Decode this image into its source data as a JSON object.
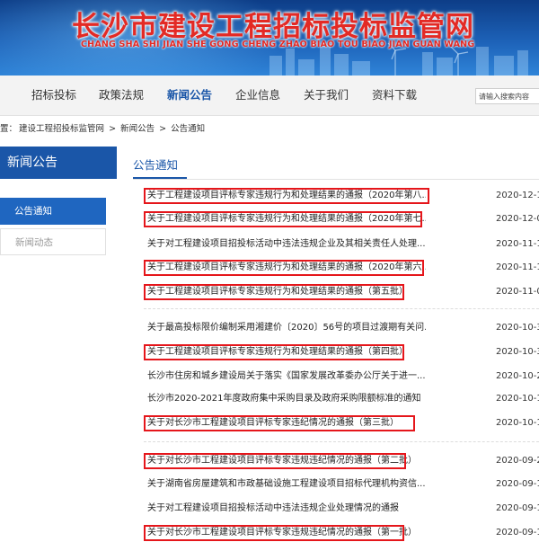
{
  "banner": {
    "title": "长沙市建设工程招标投标监管网",
    "pinyin": "CHANG SHA SHI JIAN SHE GONG CHENG ZHAO BIAO TOU BIAO JIAN GUAN WANG"
  },
  "nav": {
    "items": [
      "招标投标",
      "政策法规",
      "新闻公告",
      "企业信息",
      "关于我们",
      "资料下载"
    ],
    "active": "新闻公告",
    "search_placeholder": "请输入搜索内容"
  },
  "breadcrumb": {
    "prefix": "置：",
    "items": [
      "建设工程招投标监管网",
      ">",
      "新闻公告",
      ">",
      "公告通知"
    ]
  },
  "sidebar": {
    "heading": "新闻公告",
    "items": [
      {
        "label": "公告通知",
        "active": true
      },
      {
        "label": "新闻动态",
        "active": false
      }
    ]
  },
  "main": {
    "heading": "公告通知",
    "rows": [
      {
        "title": "关于工程建设项目评标专家违规行为和处理结果的通报（2020年第八...",
        "date": "2020-12-1",
        "highlighted": true
      },
      {
        "title": "关于工程建设项目评标专家违规行为和处理结果的通报（2020年第七...",
        "date": "2020-12-0",
        "highlighted": true
      },
      {
        "title": "关于对工程建设项目招投标活动中违法违规企业及其相关责任人处理...",
        "date": "2020-11-1",
        "highlighted": false
      },
      {
        "title": "关于工程建设项目评标专家违规行为和处理结果的通报（2020年第六...",
        "date": "2020-11-1",
        "highlighted": true
      },
      {
        "title": "关于工程建设项目评标专家违规行为和处理结果的通报（第五批）",
        "date": "2020-11-0",
        "highlighted": true
      },
      {
        "title": "关于最高投标限价编制采用湘建价〔2020〕56号的项目过渡期有关问...",
        "date": "2020-10-3",
        "highlighted": false
      },
      {
        "title": "关于工程建设项目评标专家违规行为和处理结果的通报（第四批）",
        "date": "2020-10-3",
        "highlighted": true
      },
      {
        "title": "长沙市住房和城乡建设局关于落实《国家发展改革委办公厅关于进一...",
        "date": "2020-10-2",
        "highlighted": false
      },
      {
        "title": "长沙市2020-2021年度政府集中采购目录及政府采购限额标准的通知",
        "date": "2020-10-1",
        "highlighted": false
      },
      {
        "title": "关于对长沙市工程建设项目评标专家违纪情况的通报（第三批）",
        "date": "2020-10-1",
        "highlighted": true
      },
      {
        "title": "关于对长沙市工程建设项目评标专家违规违纪情况的通报（第二批）",
        "date": "2020-09-2",
        "highlighted": true
      },
      {
        "title": "关于湖南省房屋建筑和市政基础设施工程建设项目招标代理机构资信...",
        "date": "2020-09-1",
        "highlighted": false
      },
      {
        "title": "关于对工程建设项目招投标活动中违法违规企业处理情况的通报",
        "date": "2020-09-1",
        "highlighted": false
      },
      {
        "title": "关于对长沙市工程建设项目评标专家违规违纪情况的通报（第一批）",
        "date": "2020-09-1",
        "highlighted": true
      }
    ]
  },
  "colors": {
    "brand_blue": "#1a56a8",
    "highlight_red": "#e5161b",
    "title_red": "#e32a25"
  }
}
